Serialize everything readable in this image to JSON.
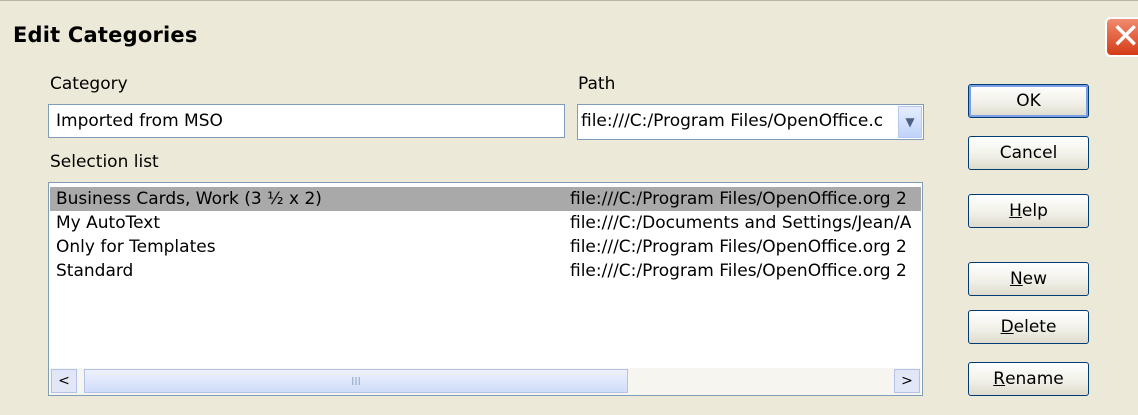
{
  "window": {
    "title": "Edit Categories"
  },
  "category": {
    "label": "Category",
    "value": "Imported from MSO"
  },
  "path": {
    "label": "Path",
    "value": "file:///C:/Program Files/OpenOffice.c"
  },
  "selection_list": {
    "label": "Selection list",
    "rows": [
      {
        "name": "Business Cards, Work (3 ½ x 2)",
        "path": "file:///C:/Program Files/OpenOffice.org 2"
      },
      {
        "name": "My AutoText",
        "path": "file:///C:/Documents and Settings/Jean/A"
      },
      {
        "name": "Only for Templates",
        "path": "file:///C:/Program Files/OpenOffice.org 2"
      },
      {
        "name": "Standard",
        "path": "file:///C:/Program Files/OpenOffice.org 2"
      }
    ],
    "selected_index": 0,
    "scroll": {
      "left_arrow": "<",
      "thumb_grip": "III",
      "right_arrow": ">"
    }
  },
  "buttons": {
    "ok": "OK",
    "cancel": "Cancel",
    "help_first": "H",
    "help_rest": "elp",
    "new_first": "N",
    "new_rest": "ew",
    "delete_first": "D",
    "delete_rest": "elete",
    "rename_first": "R",
    "rename_rest": "ename"
  },
  "icons": {
    "close": "close-icon",
    "dropdown": "chevron-down-icon"
  },
  "colors": {
    "dialog_bg": "#ece9d8",
    "selection": "#a9a9a9",
    "close_red": "#d43b16"
  }
}
